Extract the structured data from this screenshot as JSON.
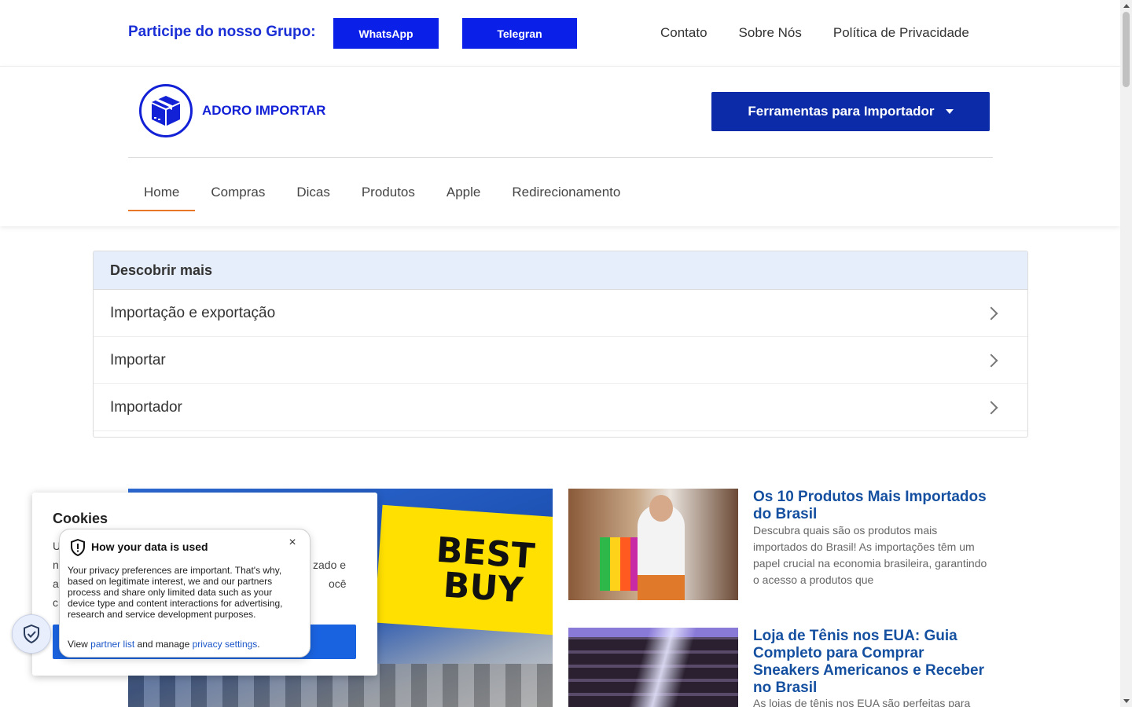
{
  "topbar": {
    "group_label": "Participe do nosso Grupo:",
    "whatsapp_label": "WhatsApp",
    "telegram_label": "Telegran",
    "links": [
      "Contato",
      "Sobre Nós",
      "Política de Privacidade"
    ]
  },
  "header": {
    "logo_text": "ADORO IMPORTAR",
    "tools_label": "Ferramentas para Importador",
    "nav": [
      "Home",
      "Compras",
      "Dicas",
      "Produtos",
      "Apple",
      "Redirecionamento"
    ],
    "active_nav": "Home"
  },
  "discover": {
    "title": "Descobrir mais",
    "items": [
      "Importação e exportação",
      "Importar",
      "Importador"
    ]
  },
  "hero": {
    "sign_line1": "BEST",
    "sign_line2": "BUY"
  },
  "articles": [
    {
      "title": "Os 10 Produtos Mais Importados do Brasil",
      "excerpt": "Descubra quais são os produtos mais importados do Brasil! As importações têm um papel crucial na economia brasileira, garantindo o acesso a produtos que"
    },
    {
      "title": "Loja de Tênis nos EUA: Guia Completo para Comprar Sneakers Americanos e Receber no Brasil",
      "excerpt": "As lojas de tênis nos EUA são perfeitas para"
    }
  ],
  "cookie": {
    "title": "Cookies",
    "peek_left": [
      "U",
      "n",
      "a",
      "c"
    ],
    "peek_right": [
      "zado e",
      "ocê"
    ]
  },
  "privacy_popover": {
    "title": "How your data is used",
    "close_glyph": "×",
    "body": "Your privacy preferences are important. That's why, based on legitimate interest, we and our partners process and share only limited data such as your device type and content interactions for advertising, research and service development purposes.",
    "foot_view": "View",
    "partner_list": "partner list",
    "foot_mid": "and manage",
    "privacy_settings": "privacy settings",
    "foot_end": "."
  },
  "colors": {
    "brand_blue": "#0a1fe8",
    "tools_blue": "#0b2ba8",
    "nav_accent": "#e8772a",
    "article_title": "#1550a0"
  }
}
